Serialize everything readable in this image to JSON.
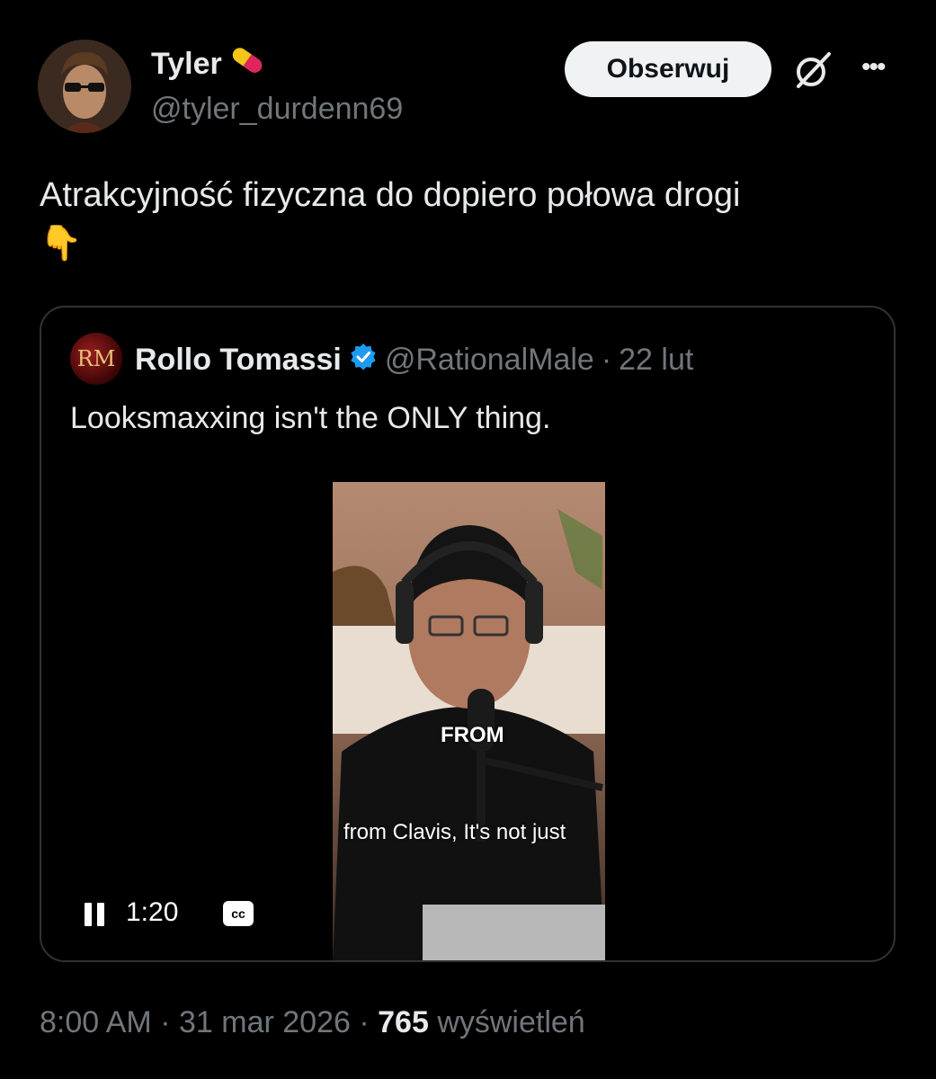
{
  "author": {
    "name": "Tyler",
    "handle": "@tyler_durdenn69",
    "badge_icon": "pill-icon"
  },
  "actions": {
    "follow_label": "Obserwuj",
    "grok_icon": "grok-icon",
    "more_icon": "more-icon"
  },
  "tweet": {
    "text": "Atrakcyjność fizyczna do dopiero połowa drogi",
    "emoji": "👇"
  },
  "quote": {
    "avatar_initials": "RM",
    "name": "Rollo Tomassi",
    "verified": true,
    "handle": "@RationalMale",
    "separator": "·",
    "date": "22 lut",
    "text": "Looksmaxxing isn't the ONLY thing.",
    "video": {
      "caption_top": "FROM",
      "caption_bottom": "from Clavis, It's not just",
      "time": "1:20",
      "cc_label": "cc"
    }
  },
  "footer": {
    "time": "8:00 AM",
    "sep1": "·",
    "date": "31 mar 2026",
    "sep2": "·",
    "views_count": "765",
    "views_label": "wyświetleń"
  },
  "colors": {
    "background": "#000000",
    "text": "#e7e9ea",
    "secondary": "#71767b",
    "border": "#2f3336",
    "verified": "#1d9bf0"
  }
}
